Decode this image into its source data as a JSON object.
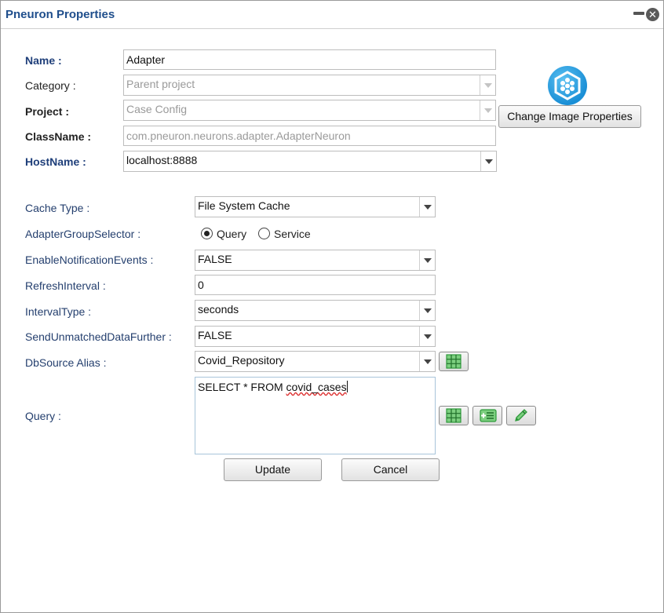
{
  "window": {
    "title": "Pneuron Properties",
    "minimize_icon": "minimize-icon",
    "close_icon": "close-circle-icon",
    "close_glyph": "✕"
  },
  "general": {
    "name_label": "Name :",
    "name_value": "Adapter",
    "category_label": "Category :",
    "category_value": "Parent project",
    "project_label": "Project :",
    "project_value": "Case Config",
    "classname_label": "ClassName :",
    "classname_value": "com.pneuron.neurons.adapter.AdapterNeuron",
    "hostname_label": "HostName :",
    "hostname_value": "localhost:8888",
    "change_image_button": "Change Image Properties",
    "logo_icon": "hexagon-neuron-icon"
  },
  "properties": {
    "cache_type_label": "Cache Type :",
    "cache_type_value": "File System Cache",
    "adapter_group_label": "AdapterGroupSelector :",
    "radio_query_label": "Query",
    "radio_service_label": "Service",
    "selected_option": "Query",
    "enable_notification_label": "EnableNotificationEvents :",
    "enable_notification_value": "FALSE",
    "refresh_interval_label": "RefreshInterval :",
    "refresh_interval_value": "0",
    "interval_type_label": "IntervalType :",
    "interval_type_value": "seconds",
    "send_unmatched_label": "SendUnmatchedDataFurther :",
    "send_unmatched_value": "FALSE",
    "dbsource_label": "DbSource Alias :",
    "dbsource_value": "Covid_Repository",
    "query_label": "Query :",
    "query_text_prefix": "SELECT * FROM ",
    "query_text_table": "covid_cases"
  },
  "icons": {
    "dbsource_grid": "table-grid-icon",
    "query_grid": "table-grid-icon",
    "query_add": "add-list-icon",
    "query_edit": "pencil-edit-icon"
  },
  "colors": {
    "title": "#1f4e8c",
    "label_blue": "#1f3f7a",
    "icon_green": "#2e9a3b",
    "logo_blue": "#1a8fd6"
  },
  "footer": {
    "update_button": "Update",
    "cancel_button": "Cancel"
  }
}
